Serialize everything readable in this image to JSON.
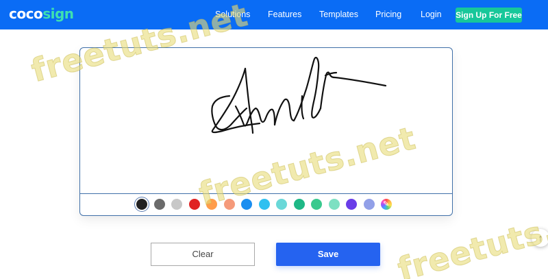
{
  "header": {
    "logo_main": "coco",
    "logo_accent": "sign",
    "nav": {
      "solutions": "Solutions",
      "features": "Features",
      "templates": "Templates",
      "pricing": "Pricing",
      "login": "Login"
    },
    "signup_label": "Sign Up For Free",
    "background_color": "#0a6cf5",
    "signup_color": "#17c79a"
  },
  "signature_pad": {
    "stroke_color": "#111111",
    "palette": [
      {
        "name": "black",
        "color": "#222222",
        "selected": true
      },
      {
        "name": "dark-gray",
        "color": "#6b6b6b"
      },
      {
        "name": "light-gray",
        "color": "#c8c8c8"
      },
      {
        "name": "red",
        "color": "#e02424"
      },
      {
        "name": "orange",
        "color": "#ff9c4a"
      },
      {
        "name": "salmon",
        "color": "#f59a7a"
      },
      {
        "name": "blue",
        "color": "#1a8ef0"
      },
      {
        "name": "sky-blue",
        "color": "#2fc0f0"
      },
      {
        "name": "light-teal",
        "color": "#6ad8d8"
      },
      {
        "name": "green",
        "color": "#1fb886"
      },
      {
        "name": "emerald",
        "color": "#3ac98e"
      },
      {
        "name": "mint",
        "color": "#7de0c2"
      },
      {
        "name": "purple",
        "color": "#6a3de8"
      },
      {
        "name": "lavender",
        "color": "#92a0e8"
      },
      {
        "name": "custom",
        "icon": "pen-icon"
      }
    ]
  },
  "actions": {
    "clear_label": "Clear",
    "save_label": "Save",
    "save_color": "#2563f0"
  },
  "scroll_top": {
    "icon": "arrow-up-icon",
    "glyph": "↑"
  },
  "watermark": {
    "text": "freetuts.net"
  }
}
